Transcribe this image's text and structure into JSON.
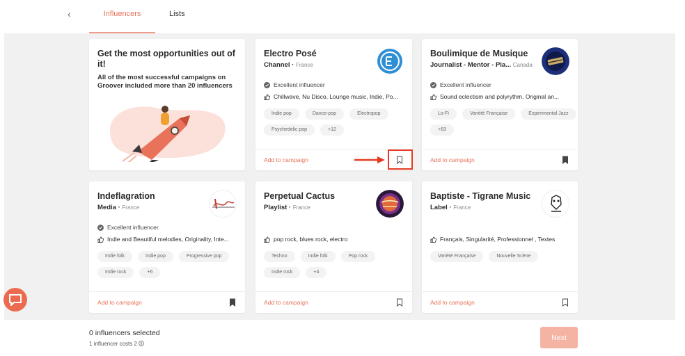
{
  "nav": {
    "back_icon": "chevron-left-icon",
    "back_glyph": "‹",
    "tabs": [
      {
        "label": "Influencers",
        "active": true
      },
      {
        "label": "Lists",
        "active": false
      }
    ]
  },
  "promo": {
    "title": "Get the most opportunities out of it!",
    "body": "All of the most successful campaigns on Groover included more than 20 influencers"
  },
  "cards": [
    {
      "name": "Electro Posé",
      "role": "Channel",
      "country": "France",
      "status": "Excellent influencer",
      "description": "Chillwave, Nu Disco, Lounge music, Indie, Po...",
      "tags": [
        "Indie pop",
        "Dance-pop",
        "Electropop",
        "Psychedelic pop",
        "+12"
      ],
      "add_label": "Add to campaign",
      "bookmarked": false
    },
    {
      "name": "Boulimique de Musique",
      "role": "Journalist - Mentor - Pla...",
      "country": "Canada",
      "status": "Excellent influencer",
      "description": "Sound eclectism and polyrythm, Original an...",
      "tags": [
        "Lo-Fi",
        "Variété Française",
        "Experimental Jazz",
        "+63"
      ],
      "add_label": "Add to campaign",
      "bookmarked": true
    },
    {
      "name": "Indeflagration",
      "role": "Media",
      "country": "France",
      "status": "Excellent influencer",
      "description": "Indie and Beautiful melodies, Originality, Inte...",
      "tags": [
        "Indie folk",
        "Indie pop",
        "Progressive pop",
        "Indie rock",
        "+6"
      ],
      "add_label": "Add to campaign",
      "bookmarked": true
    },
    {
      "name": "Perpetual Cactus",
      "role": "Playlist",
      "country": "France",
      "status": "",
      "description": "pop rock, blues rock, electro",
      "tags": [
        "Techno",
        "Indie folk",
        "Pop rock",
        "Indie rock",
        "+4"
      ],
      "add_label": "Add to campaign",
      "bookmarked": false
    },
    {
      "name": "Baptiste - Tigrane Music",
      "role": "Label",
      "country": "France",
      "status": "",
      "description": "Français, Singularité, Professionnel , Textes",
      "tags": [
        "Variété Française",
        "Nouvelle Scène"
      ],
      "add_label": "Add to campaign",
      "bookmarked": false
    }
  ],
  "footer": {
    "selected": "0 influencers selected",
    "cost": "1 influencer costs 2",
    "next_label": "Next"
  },
  "colors": {
    "accent": "#e8735a",
    "highlight": "#e53a21",
    "background": "#f1f1f1"
  }
}
